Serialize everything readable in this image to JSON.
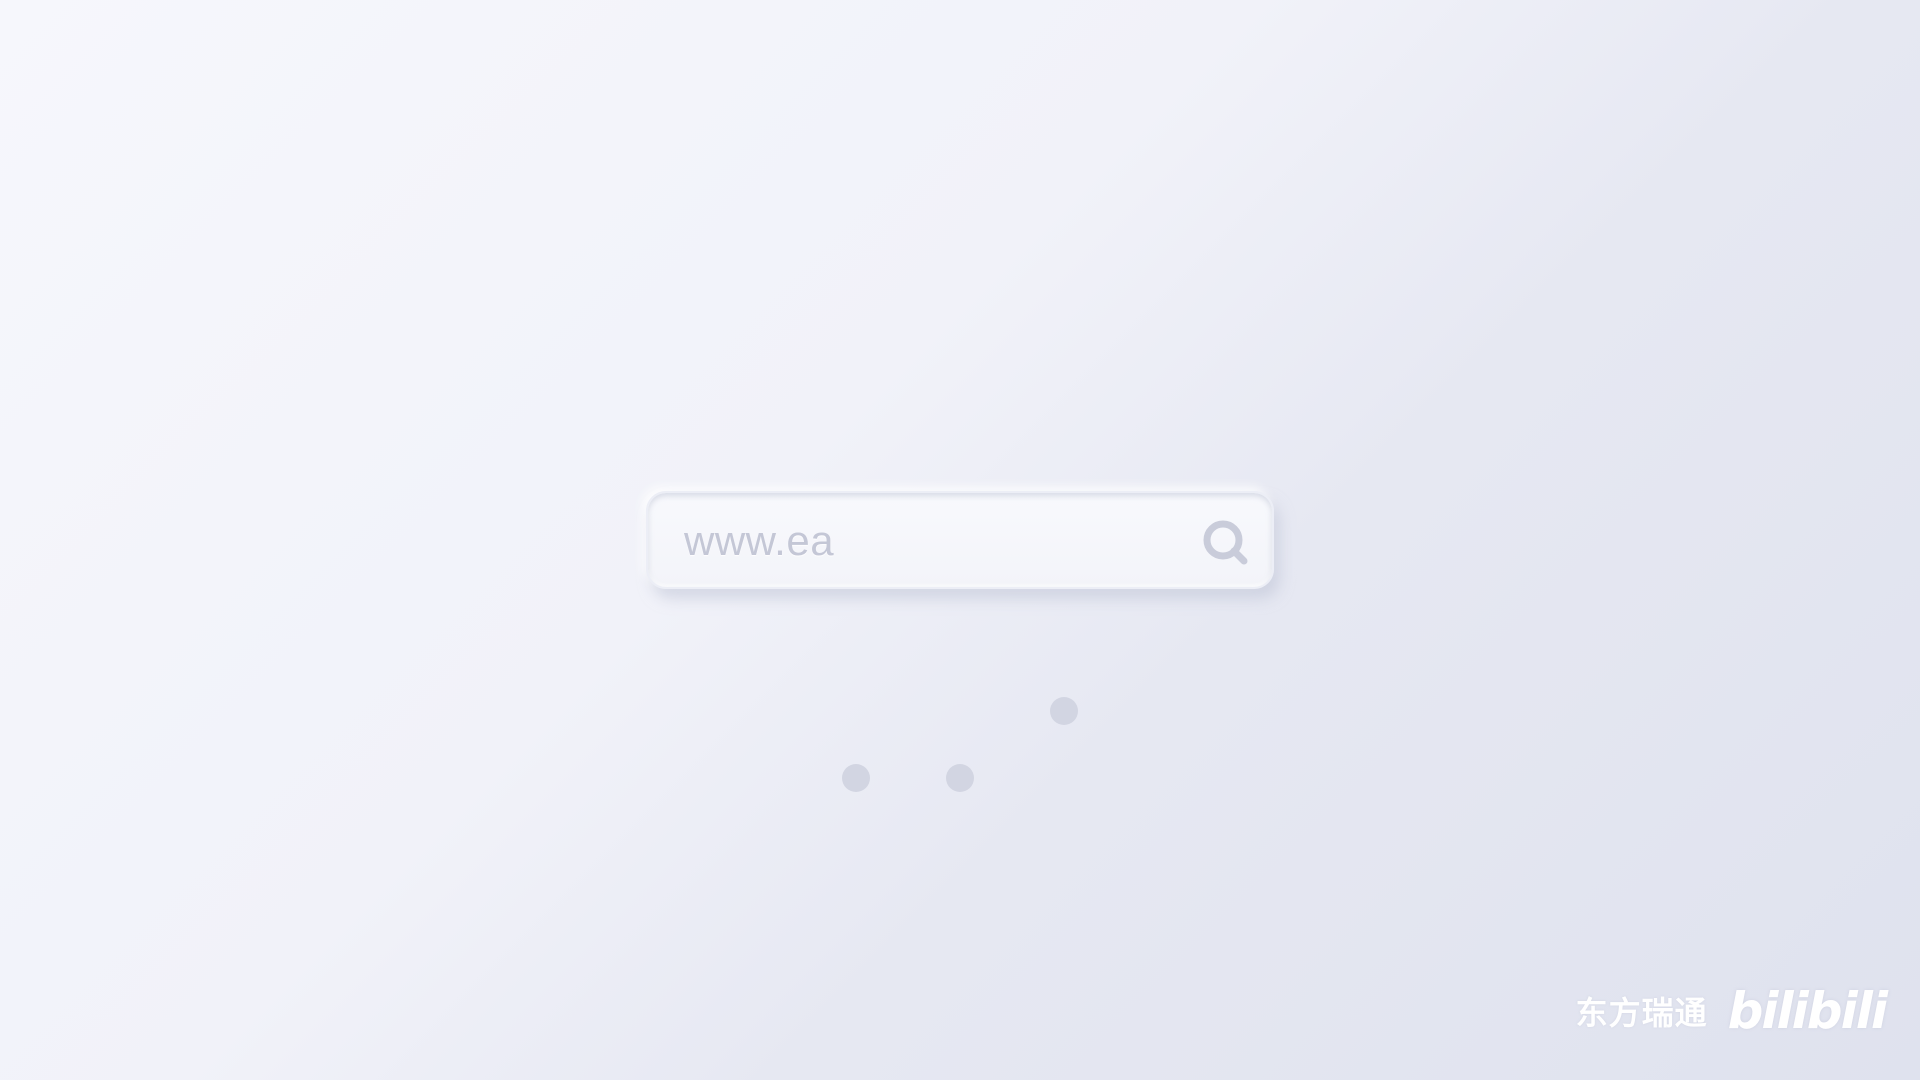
{
  "search": {
    "value": "www.ea",
    "icon": "search-icon"
  },
  "loading": {
    "dot_count": 3,
    "dot_color": "#d2d5e2"
  },
  "watermark": {
    "text": "东方瑞通",
    "logo": "bilibili"
  },
  "colors": {
    "background": "#f1f2f9",
    "bar": "#f5f6fb",
    "text": "#c4c7d6",
    "icon": "#c9ccda"
  }
}
